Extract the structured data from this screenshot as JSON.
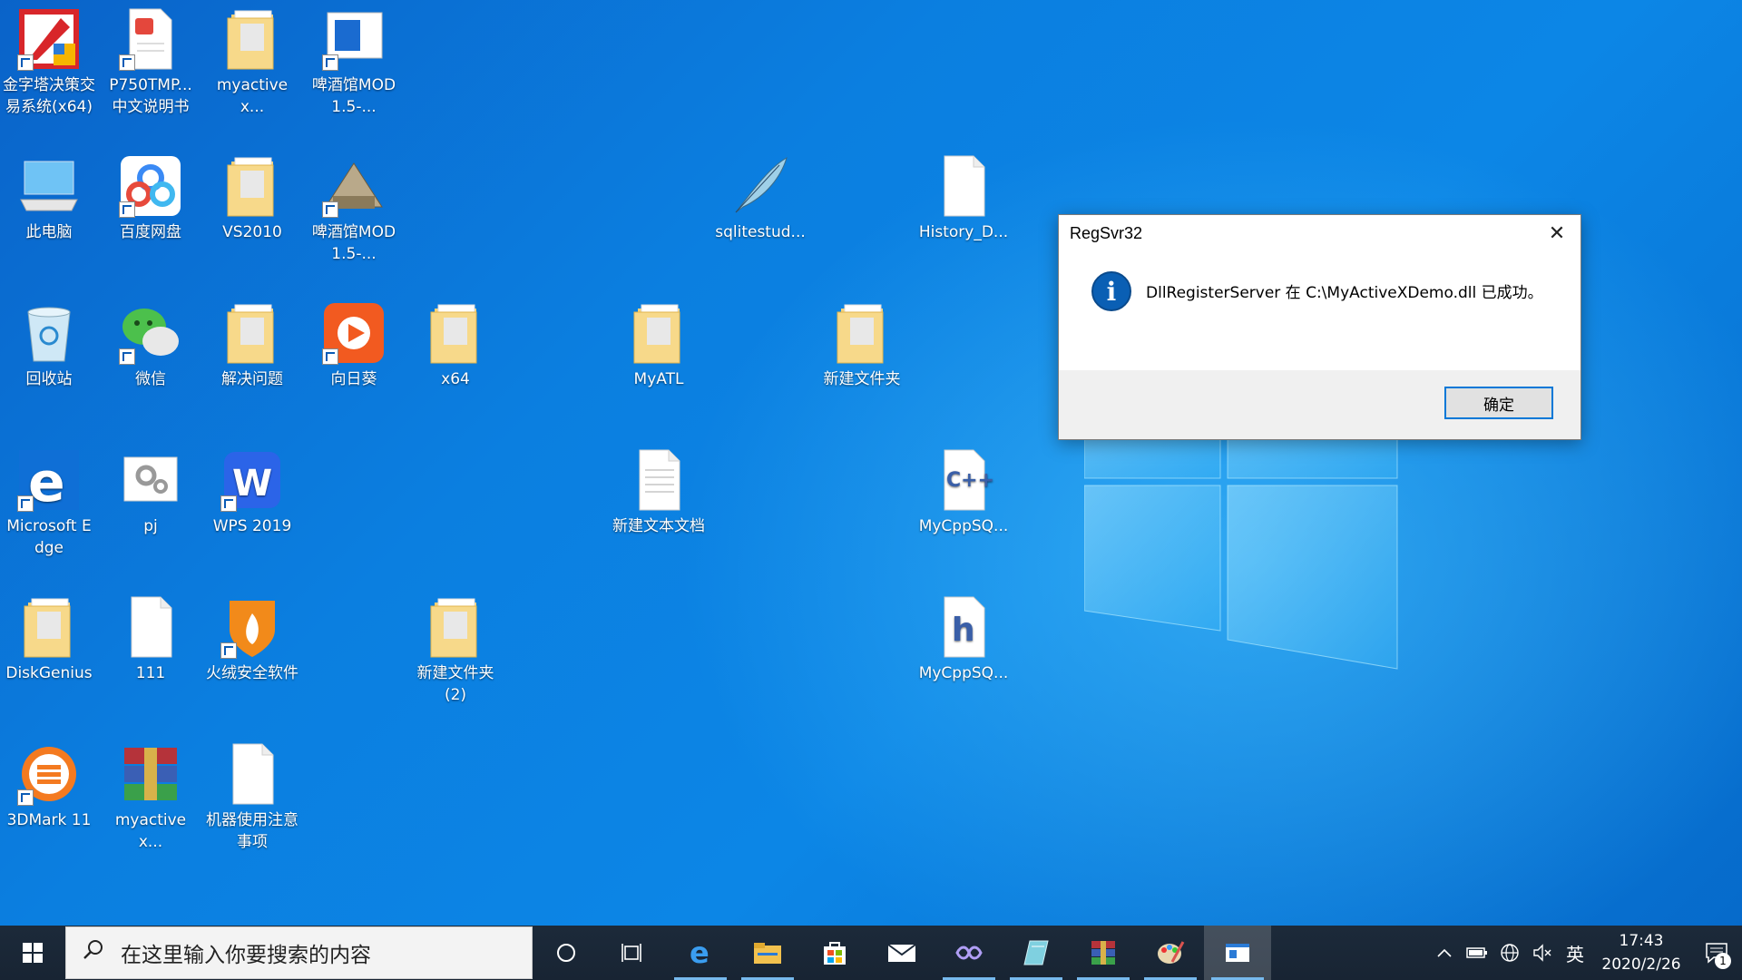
{
  "desktop": {
    "icons": [
      {
        "label": "金字塔决策交易系统(x64)",
        "icon": "pyramid-app-icon"
      },
      {
        "label": "P750TMP...中文说明书",
        "icon": "pdf-document-icon"
      },
      {
        "label": "myactivex...",
        "icon": "folder-icon"
      },
      {
        "label": "啤酒馆MOD1.5-...",
        "icon": "app-window-icon"
      },
      {
        "label": "此电脑",
        "icon": "computer-icon"
      },
      {
        "label": "百度网盘",
        "icon": "baidu-netdisk-icon"
      },
      {
        "label": "VS2010",
        "icon": "folder-icon"
      },
      {
        "label": "啤酒馆MOD1.5-...",
        "icon": "game-icon"
      },
      {
        "label": "sqlitestud...",
        "icon": "feather-icon"
      },
      {
        "label": "History_D...",
        "icon": "file-icon"
      },
      {
        "label": "回收站",
        "icon": "recycle-bin-icon"
      },
      {
        "label": "微信",
        "icon": "wechat-icon"
      },
      {
        "label": "解决问题",
        "icon": "folder-icon"
      },
      {
        "label": "向日葵",
        "icon": "sunflower-icon"
      },
      {
        "label": "x64",
        "icon": "folder-icon"
      },
      {
        "label": "MyATL",
        "icon": "folder-icon"
      },
      {
        "label": "新建文件夹",
        "icon": "folder-icon"
      },
      {
        "label": "Microsoft Edge",
        "icon": "edge-icon"
      },
      {
        "label": "pj",
        "icon": "settings-file-icon"
      },
      {
        "label": "WPS 2019",
        "icon": "wps-icon"
      },
      {
        "label": "新建文本文档",
        "icon": "text-file-icon"
      },
      {
        "label": "MyCppSQ...",
        "icon": "cpp-file-icon"
      },
      {
        "label": "DiskGenius",
        "icon": "folder-icon"
      },
      {
        "label": "111",
        "icon": "file-icon"
      },
      {
        "label": "火绒安全软件",
        "icon": "huorong-icon"
      },
      {
        "label": "新建文件夹(2)",
        "icon": "folder-icon"
      },
      {
        "label": "MyCppSQ...",
        "icon": "h-file-icon"
      },
      {
        "label": "3DMark 11",
        "icon": "3dmark-icon"
      },
      {
        "label": "myactivex...",
        "icon": "winrar-icon"
      },
      {
        "label": "机器使用注意事项",
        "icon": "file-icon"
      }
    ]
  },
  "dialog": {
    "title": "RegSvr32",
    "message": "DllRegisterServer 在 C:\\MyActiveXDemo.dll 已成功。",
    "ok_label": "确定",
    "close_glyph": "✕"
  },
  "taskbar": {
    "search_placeholder": "在这里输入你要搜索的内容",
    "apps": [
      "cortana-icon",
      "task-view-icon",
      "edge-icon",
      "file-explorer-icon",
      "store-icon",
      "mail-icon",
      "visual-studio-icon",
      "notepad-icon",
      "winrar-icon",
      "paint-icon",
      "regsvr-window-icon"
    ],
    "tray": {
      "ime": "英",
      "time": "17:43",
      "date": "2020/2/26",
      "notification_count": "1"
    }
  },
  "colors": {
    "desktop_bg": "#0a7ad8",
    "taskbar_bg": "#1b2838",
    "accent": "#0078d7"
  }
}
